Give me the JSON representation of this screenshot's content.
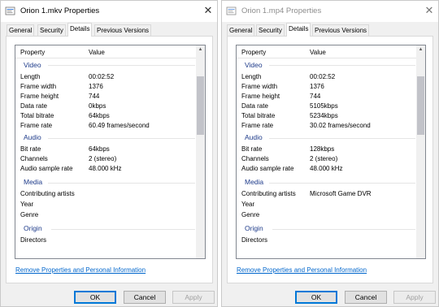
{
  "left": {
    "title": "Orion 1.mkv Properties",
    "tabs": [
      "General",
      "Security",
      "Details",
      "Previous Versions"
    ],
    "header": {
      "property": "Property",
      "value": "Value"
    },
    "groups": {
      "video": "Video",
      "audio": "Audio",
      "media": "Media",
      "origin": "Origin"
    },
    "rows": {
      "length": {
        "label": "Length",
        "value": "00:02:52"
      },
      "frame_width": {
        "label": "Frame width",
        "value": "1376"
      },
      "frame_height": {
        "label": "Frame height",
        "value": "744"
      },
      "data_rate": {
        "label": "Data rate",
        "value": "0kbps"
      },
      "total_bitrate": {
        "label": "Total bitrate",
        "value": "64kbps"
      },
      "frame_rate": {
        "label": "Frame rate",
        "value": "60.49 frames/second"
      },
      "bit_rate": {
        "label": "Bit rate",
        "value": "64kbps"
      },
      "channels": {
        "label": "Channels",
        "value": "2 (stereo)"
      },
      "sample_rate": {
        "label": "Audio sample rate",
        "value": "48.000 kHz"
      },
      "contributing": {
        "label": "Contributing artists",
        "value": ""
      },
      "year": {
        "label": "Year",
        "value": ""
      },
      "genre": {
        "label": "Genre",
        "value": ""
      },
      "directors": {
        "label": "Directors",
        "value": ""
      }
    },
    "link": "Remove Properties and Personal Information",
    "buttons": {
      "ok": "OK",
      "cancel": "Cancel",
      "apply": "Apply"
    }
  },
  "right": {
    "title": "Orion 1.mp4 Properties",
    "tabs": [
      "General",
      "Security",
      "Details",
      "Previous Versions"
    ],
    "header": {
      "property": "Property",
      "value": "Value"
    },
    "groups": {
      "video": "Video",
      "audio": "Audio",
      "media": "Media",
      "origin": "Origin"
    },
    "rows": {
      "length": {
        "label": "Length",
        "value": "00:02:52"
      },
      "frame_width": {
        "label": "Frame width",
        "value": "1376"
      },
      "frame_height": {
        "label": "Frame height",
        "value": "744"
      },
      "data_rate": {
        "label": "Data rate",
        "value": "5105kbps"
      },
      "total_bitrate": {
        "label": "Total bitrate",
        "value": "5234kbps"
      },
      "frame_rate": {
        "label": "Frame rate",
        "value": "30.02 frames/second"
      },
      "bit_rate": {
        "label": "Bit rate",
        "value": "128kbps"
      },
      "channels": {
        "label": "Channels",
        "value": "2 (stereo)"
      },
      "sample_rate": {
        "label": "Audio sample rate",
        "value": "48.000 kHz"
      },
      "contributing": {
        "label": "Contributing artists",
        "value": "Microsoft Game DVR"
      },
      "year": {
        "label": "Year",
        "value": ""
      },
      "genre": {
        "label": "Genre",
        "value": ""
      },
      "directors": {
        "label": "Directors",
        "value": ""
      }
    },
    "link": "Remove Properties and Personal Information",
    "buttons": {
      "ok": "OK",
      "cancel": "Cancel",
      "apply": "Apply"
    }
  },
  "icons": {
    "app": "file-properties-icon",
    "close": "close-icon",
    "scroll_up": "scroll-up-arrow-icon"
  }
}
